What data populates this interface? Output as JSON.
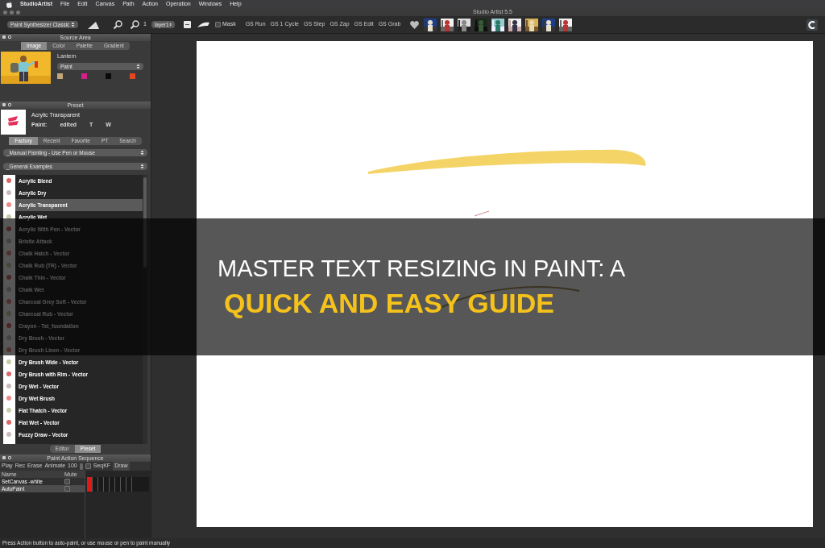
{
  "menu_bar": {
    "app_name": "StudioArtist",
    "items": [
      "File",
      "Edit",
      "Canvas",
      "Path",
      "Action",
      "Operation",
      "Windows",
      "Help"
    ]
  },
  "window": {
    "title": "Studio Artist 5.5"
  },
  "toolbar": {
    "synth_dropdown": "Paint Synthesizer Classic",
    "zoom_level": "1",
    "layer_dropdown": "layer1",
    "mask": {
      "label": "Mask",
      "checked": false
    },
    "gallery_buttons": [
      "GS Run",
      "GS 1 Cycle",
      "GS Step",
      "GS Zap",
      "GS Edit",
      "GS Grab"
    ]
  },
  "source_area": {
    "title": "Source Area",
    "tabs": [
      {
        "label": "Image",
        "selected": true
      },
      {
        "label": "Color",
        "selected": false
      },
      {
        "label": "Palette",
        "selected": false
      },
      {
        "label": "Gradient",
        "selected": false
      }
    ],
    "image_name": "Lantern",
    "paint_dropdown": "Paint",
    "swatches": [
      {
        "color": "#c4a57a"
      },
      {
        "color": "#d4208a"
      },
      {
        "color": "#0a0a0a"
      },
      {
        "color": "#e2471f"
      }
    ]
  },
  "preset": {
    "title": "Preset",
    "name": "Acrylic Transparent",
    "details": [
      "Paint:",
      "edited",
      "T",
      "W"
    ],
    "tabs": [
      {
        "label": "Factory",
        "selected": true
      },
      {
        "label": "Recent",
        "selected": false
      },
      {
        "label": "Favorite",
        "selected": false
      },
      {
        "label": "PT",
        "selected": false
      },
      {
        "label": "Search",
        "selected": false
      }
    ],
    "category_dropdown": "_Manual Painting - Use Pen or Mouse",
    "group_dropdown": "_General Examples",
    "items": [
      {
        "label": "Acrylic Blend",
        "selected": false
      },
      {
        "label": "Acrylic Dry",
        "selected": false
      },
      {
        "label": "Acrylic Transparent",
        "selected": true
      },
      {
        "label": "Acrylic Wet",
        "selected": false
      },
      {
        "label": "Acrylic With Pen - Vector",
        "selected": false
      },
      {
        "label": "Bristle Attack",
        "selected": false
      },
      {
        "label": "Chalk Hatch - Vector",
        "selected": false
      },
      {
        "label": "Chalk Rub (TR) - Vector",
        "selected": false
      },
      {
        "label": "Chalk Thin - Vector",
        "selected": false
      },
      {
        "label": "Chalk Wet",
        "selected": false
      },
      {
        "label": "Charcoal Grey Soft - Vector",
        "selected": false
      },
      {
        "label": "Charcoal Rub - Vector",
        "selected": false
      },
      {
        "label": "Crayon - Tst_foundation",
        "selected": false
      },
      {
        "label": "Dry Brush - Vector",
        "selected": false
      },
      {
        "label": "Dry Brush Linen - Vector",
        "selected": false
      },
      {
        "label": "Dry Brush Wide - Vector",
        "selected": false
      },
      {
        "label": "Dry Brush with Rim - Vector",
        "selected": false
      },
      {
        "label": "Dry Wet - Vector",
        "selected": false
      },
      {
        "label": "Dry Wet Brush",
        "selected": false
      },
      {
        "label": "Flat Thatch - Vector",
        "selected": false
      },
      {
        "label": "Flat Wet - Vector",
        "selected": false
      },
      {
        "label": "Fuzzy Draw - Vector",
        "selected": false
      }
    ],
    "bottom_tabs": [
      {
        "label": "Editor",
        "selected": false
      },
      {
        "label": "Preset",
        "selected": true
      }
    ]
  },
  "paint_action_sequence": {
    "title": "Paint Action Sequence",
    "controls": [
      "Play",
      "Rec",
      "Erase",
      "Animate"
    ],
    "frames": "100",
    "seq_kf": {
      "label": "SeqKF",
      "checked": false
    },
    "draw_button": "Draw",
    "columns": [
      "Name",
      "Mute"
    ],
    "rows": [
      {
        "name": "SetCanvas -white",
        "mute": false,
        "selected": false,
        "keyframe": true
      },
      {
        "name": "AutoPaint",
        "mute": false,
        "selected": true,
        "keyframe": true
      }
    ]
  },
  "status_bar": "Press Action button to auto-paint, or use mouse or pen to paint manually",
  "overlay_title": {
    "line_1": "MASTER TEXT RESIZING IN PAINT: A",
    "line_2": "QUICK AND EASY GUIDE"
  }
}
